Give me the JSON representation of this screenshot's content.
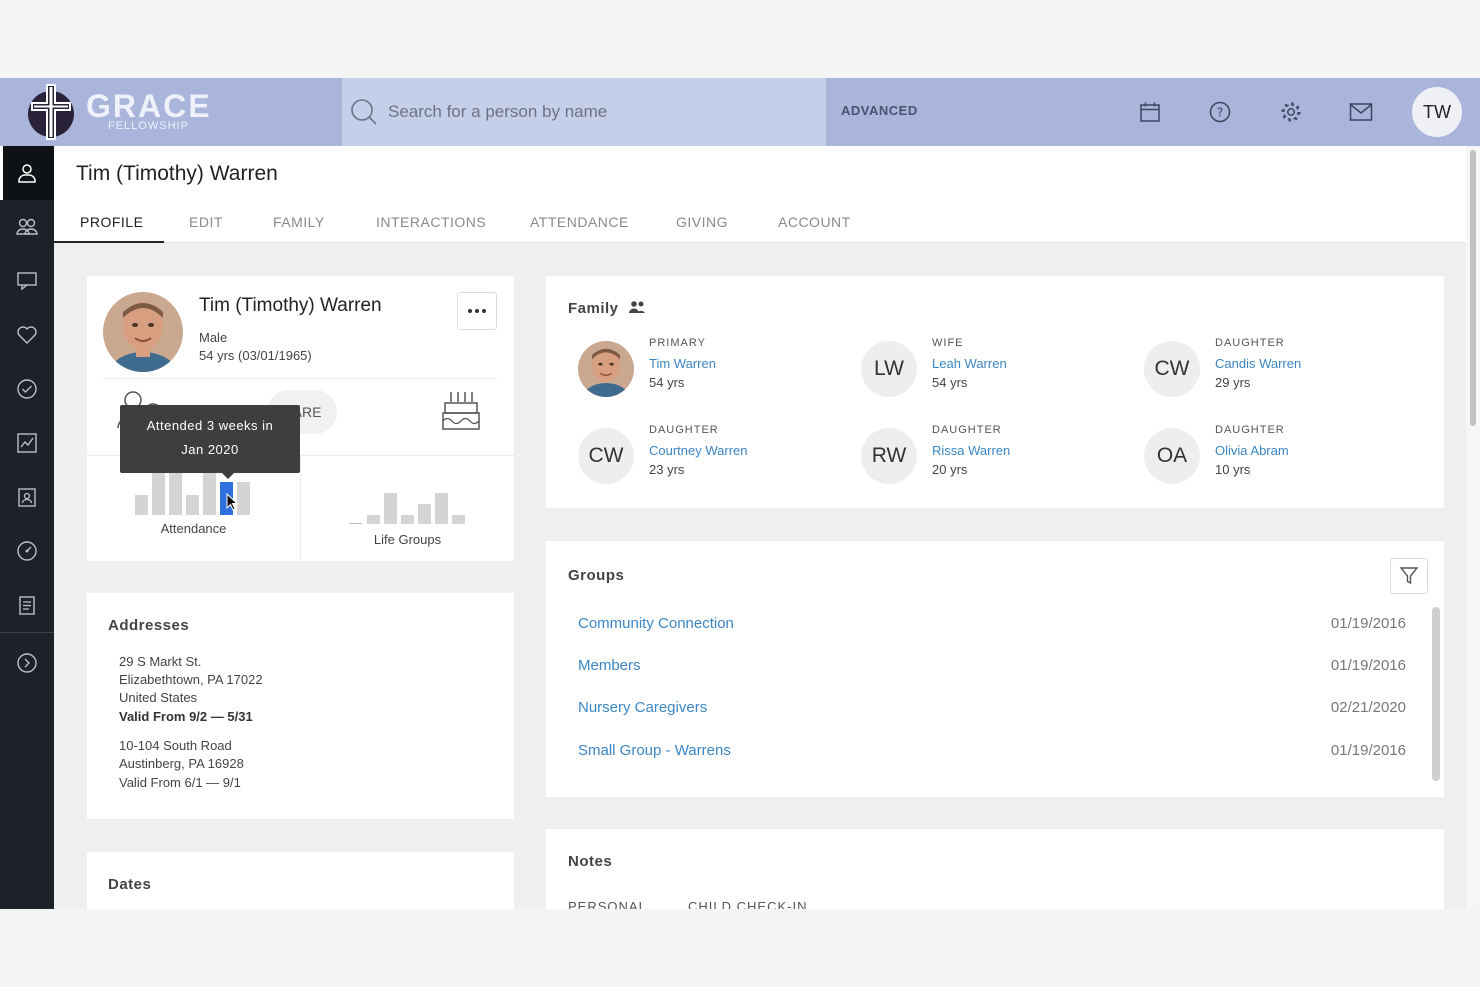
{
  "app": {
    "logo_word": "GRACE",
    "logo_sub": "FELLOWSHIP",
    "search_placeholder": "Search for a person by name",
    "advanced_label": "ADVANCED",
    "user_initials": "TW",
    "header_icons": [
      "calendar-icon",
      "help-icon",
      "gear-icon",
      "mail-icon"
    ]
  },
  "sidebar": {
    "items": [
      "person-icon",
      "people-icon",
      "chat-icon",
      "heart-icon",
      "check-circle-icon",
      "chart-icon",
      "contact-card-icon",
      "gauge-icon",
      "report-icon",
      "expand-arrow-icon"
    ]
  },
  "page": {
    "title": "Tim (Timothy) Warren",
    "tabs": [
      "PROFILE",
      "EDIT",
      "FAMILY",
      "INTERACTIONS",
      "ATTENDANCE",
      "GIVING",
      "ACCOUNT"
    ],
    "active_tab": "PROFILE"
  },
  "profile": {
    "name": "Tim (Timothy) Warren",
    "gender": "Male",
    "age": "54 yrs (03/01/1965)",
    "care_label": "CARE",
    "tooltip_line1": "Attended 3 weeks in",
    "tooltip_line2": "Jan 2020",
    "attendance_label": "Attendance",
    "life_groups_label": "Life Groups"
  },
  "family": {
    "title": "Family",
    "members": [
      {
        "role": "PRIMARY",
        "name": "Tim Warren",
        "age": "54 yrs",
        "initials": ""
      },
      {
        "role": "WIFE",
        "name": "Leah Warren",
        "age": "54 yrs",
        "initials": "LW"
      },
      {
        "role": "DAUGHTER",
        "name": "Candis Warren",
        "age": "29 yrs",
        "initials": "CW"
      },
      {
        "role": "DAUGHTER",
        "name": "Courtney Warren",
        "age": "23 yrs",
        "initials": "CW"
      },
      {
        "role": "DAUGHTER",
        "name": "Rissa Warren",
        "age": "20 yrs",
        "initials": "RW"
      },
      {
        "role": "DAUGHTER",
        "name": "Olivia Abram",
        "age": "10 yrs",
        "initials": "OA"
      }
    ]
  },
  "groups": {
    "title": "Groups",
    "rows": [
      {
        "name": "Community Connection",
        "date": "01/19/2016"
      },
      {
        "name": "Members",
        "date": "01/19/2016"
      },
      {
        "name": "Nursery Caregivers",
        "date": "02/21/2020"
      },
      {
        "name": "Small Group - Warrens",
        "date": "01/19/2016"
      }
    ]
  },
  "addresses": {
    "title": "Addresses",
    "items": [
      {
        "street": "29 S Markt St.",
        "city": "Elizabethtown, PA 17022",
        "country": "United States",
        "valid": "Valid From 9/2 — 5/31"
      },
      {
        "street": "10-104 South Road",
        "city": "Austinberg, PA 16928",
        "valid": "Valid From 6/1 — 9/1"
      }
    ]
  },
  "dates": {
    "title": "Dates"
  },
  "notes": {
    "title": "Notes",
    "columns": [
      "PERSONAL",
      "CHILD CHECK-IN"
    ]
  }
}
